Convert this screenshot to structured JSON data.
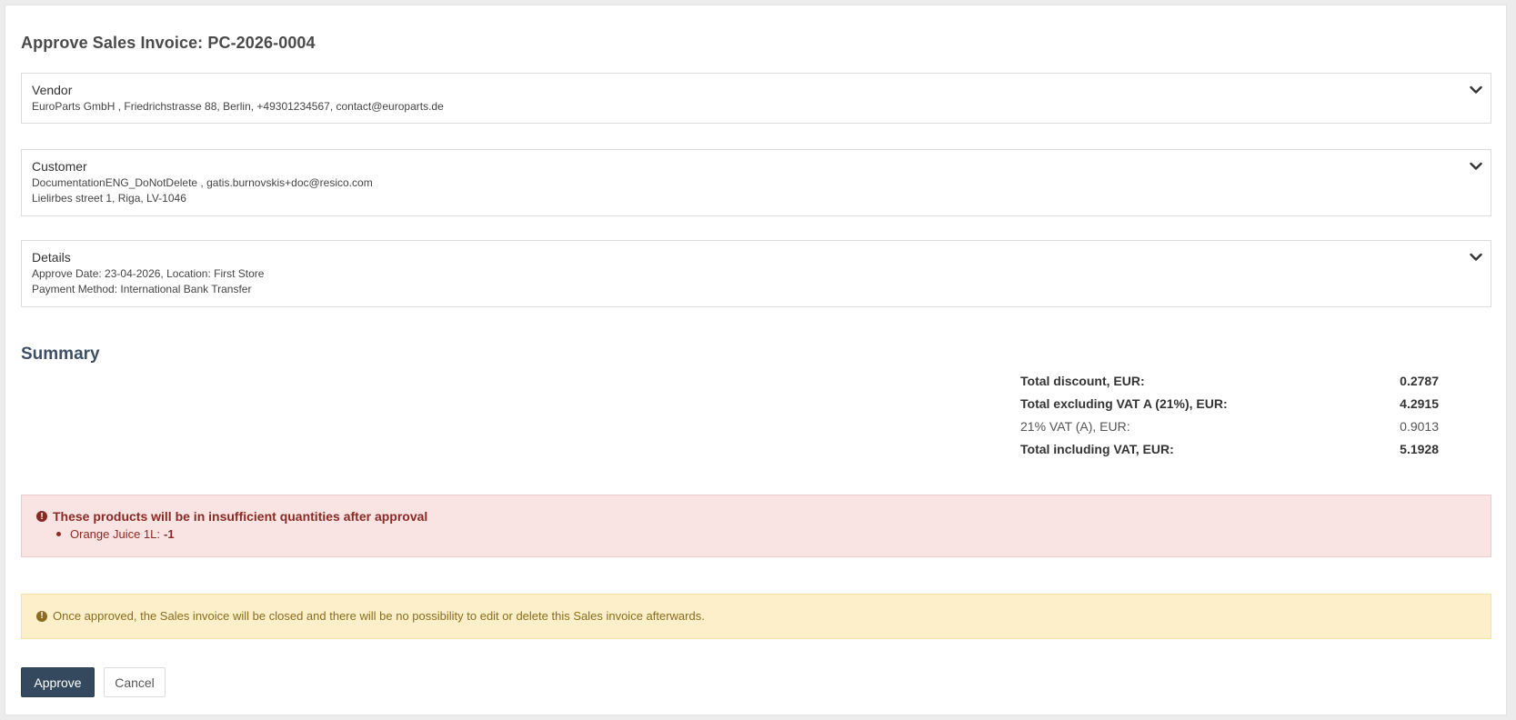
{
  "page": {
    "title": "Approve Sales Invoice: PC-2026-0004"
  },
  "vendor": {
    "heading": "Vendor",
    "line1": "EuroParts GmbH , Friedrichstrasse 88, Berlin, +49301234567, contact@europarts.de",
    "toggle_icon": "chevron-down-icon"
  },
  "customer": {
    "heading": "Customer",
    "line1": "DocumentationENG_DoNotDelete , gatis.burnovskis+doc@resico.com",
    "line2": "Lielirbes street 1, Riga, LV-1046",
    "toggle_icon": "chevron-down-icon"
  },
  "details": {
    "heading": "Details",
    "line1": "Approve Date: 23-04-2026, Location: First Store",
    "line2": "Payment Method: International Bank Transfer",
    "toggle_icon": "chevron-down-icon"
  },
  "summary": {
    "heading": "Summary",
    "rows": [
      {
        "label": "Total discount, EUR:",
        "value": "0.2787"
      },
      {
        "label": "Total excluding VAT A (21%), EUR:",
        "value": "4.2915"
      },
      {
        "label": "21% VAT (A), EUR:",
        "value": "0.9013"
      },
      {
        "label": "Total including VAT, EUR:",
        "value": "5.1928"
      }
    ]
  },
  "danger_alert": {
    "icon": "exclamation-circle-icon",
    "heading": "These products will be in insufficient quantities after approval",
    "items": [
      {
        "name": "Orange Juice 1L:",
        "quantity": "-1"
      }
    ],
    "color": "#8a2a24"
  },
  "warning_alert": {
    "icon": "exclamation-circle-icon",
    "message": "Once approved, the Sales invoice will be closed and there will be no possibility to edit or delete this Sales invoice afterwards.",
    "color": "#8a6d1e"
  },
  "actions": {
    "approve_label": "Approve",
    "cancel_label": "Cancel",
    "approve_color": "#34495e"
  }
}
